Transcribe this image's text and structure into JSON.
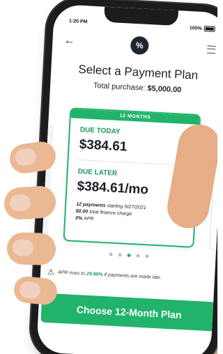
{
  "status_bar": {
    "time": "1:20 PM",
    "battery": "100%"
  },
  "nav": {
    "back_icon": "back-arrow-icon",
    "logo_icon": "percent-logo-icon",
    "logo_glyph": "%",
    "menu_icon": "hamburger-menu-icon"
  },
  "header": {
    "title": "Select a Payment Plan",
    "total_label": "Total purchase:",
    "total_value": "$5,000.00"
  },
  "plan_card": {
    "tag": "12 MONTHS",
    "due_today_label": "DUE TODAY",
    "due_today_amount": "$384.61",
    "due_later_label": "DUE LATER",
    "due_later_amount": "$384.61/mo",
    "payments_count": "12 payments",
    "payments_start": "starting 9/27/2021",
    "finance_charge_value": "$0.00",
    "finance_charge_label": "total finance charge",
    "apr_value": "0%",
    "apr_label": "APR"
  },
  "carousel": {
    "total": 5,
    "active_index": 2
  },
  "apr_note": {
    "icon": "warning-icon",
    "prefix": "APR rises to",
    "rate": "29.99%",
    "suffix": "if payments are made late."
  },
  "cta": {
    "label": "Choose 12-Month Plan"
  },
  "colors": {
    "accent": "#22b36b",
    "accent_text": "#18985a",
    "text": "#1a1f28",
    "phone_body": "#1c1c1e"
  }
}
